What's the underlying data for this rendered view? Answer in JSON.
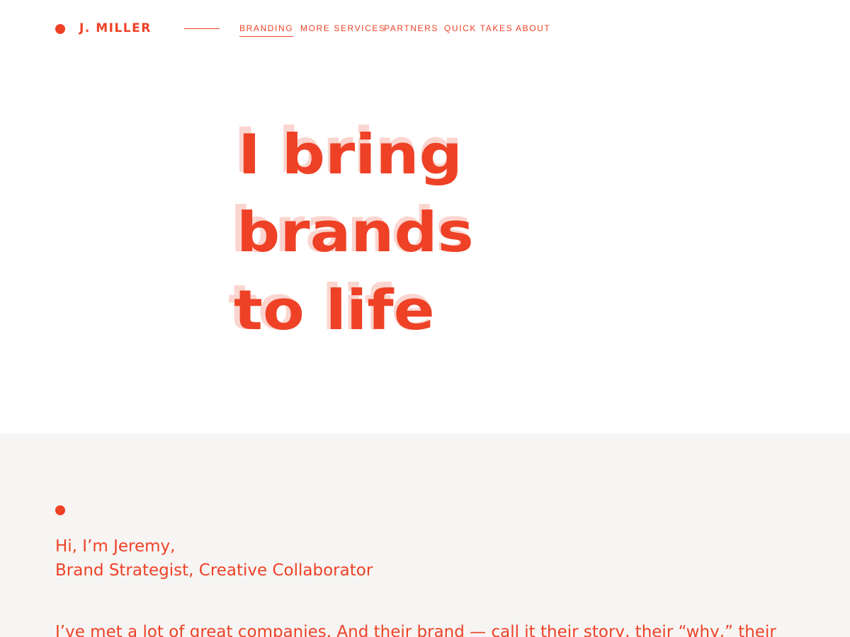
{
  "header": {
    "logo_text": "J. MILLER",
    "nav": [
      {
        "label": "BRANDING",
        "active": true
      },
      {
        "label": "MORE SERVICES",
        "active": false
      },
      {
        "label": "PARTNERS",
        "active": false
      },
      {
        "label": "QUICK TAKES",
        "active": false
      },
      {
        "label": "ABOUT",
        "active": false
      }
    ]
  },
  "hero": {
    "lines": [
      "I bring",
      "brands",
      "to life"
    ]
  },
  "about": {
    "greeting": "Hi, I’m Jeremy,",
    "role": "Brand Strategist, Creative Collaborator",
    "story": "I’ve met a lot of great companies. And their brand — call it their story, their “why,” their"
  },
  "colors": {
    "accent": "#ee4126",
    "section_background": "#f7f5f3",
    "page_background": "#ffffff"
  }
}
